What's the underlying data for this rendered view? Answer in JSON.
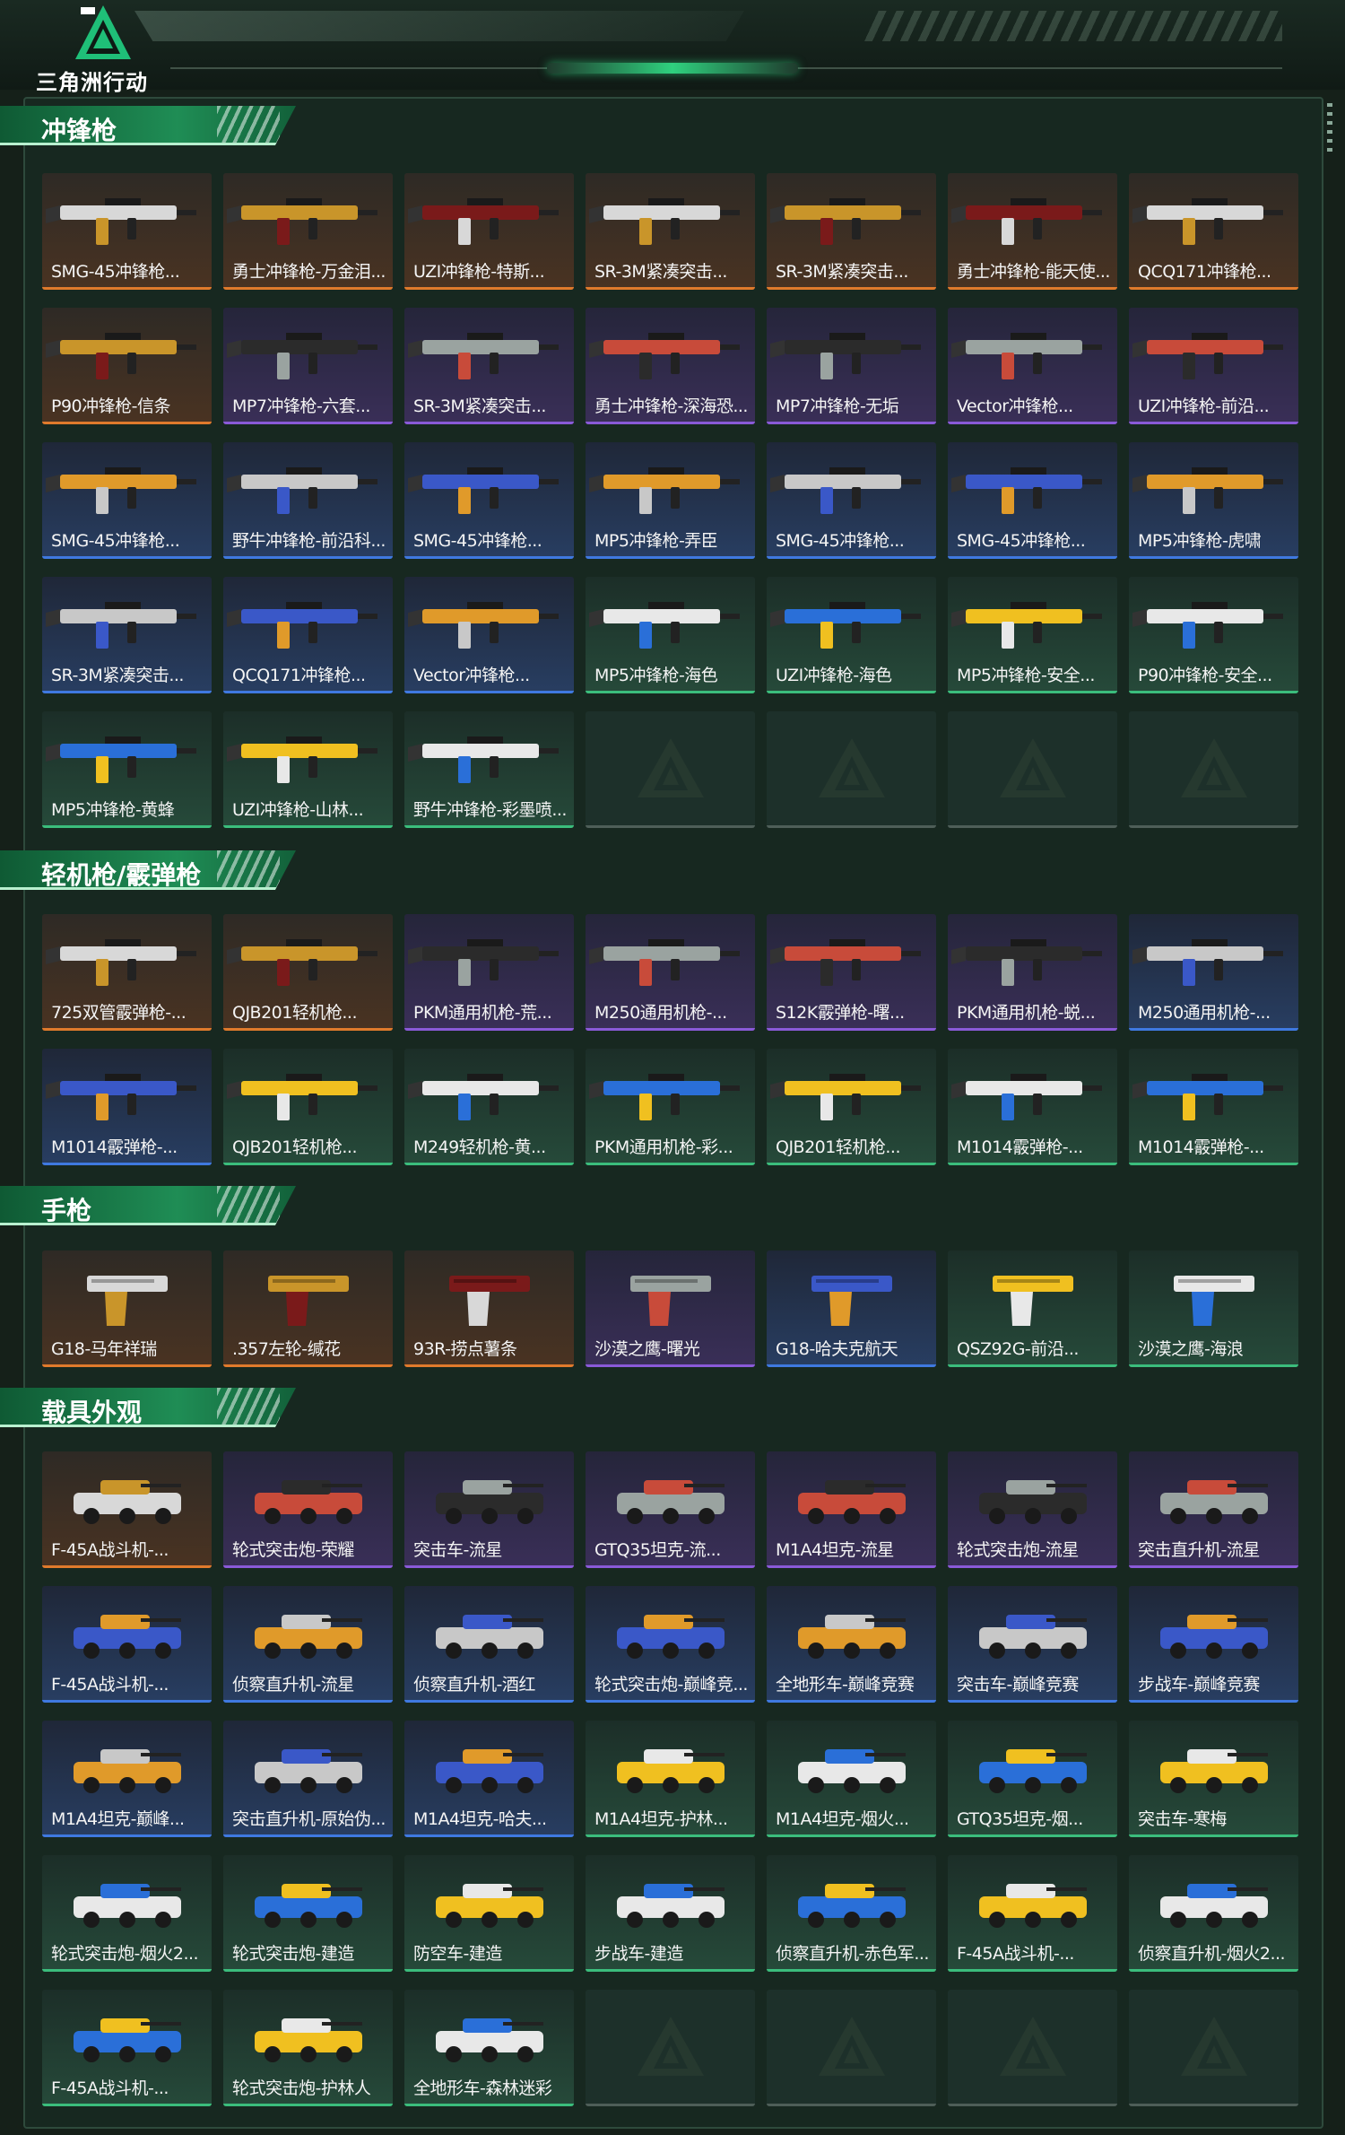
{
  "app": {
    "logo_text": "三角洲行动"
  },
  "colors": {
    "orange": "#e07a2c",
    "purple": "#8a5ad8",
    "blue": "#3f79e0",
    "green": "#3bbd7c",
    "accent": "#1f8d55"
  },
  "sections": [
    {
      "title": "冲锋枪",
      "kind": "gun",
      "items": [
        {
          "name": "SMG-45冲锋枪...",
          "rarity": "orange"
        },
        {
          "name": "勇士冲锋枪-万金泪...",
          "rarity": "orange"
        },
        {
          "name": "UZI冲锋枪-特斯...",
          "rarity": "orange"
        },
        {
          "name": "SR-3M紧凑突击...",
          "rarity": "orange"
        },
        {
          "name": "SR-3M紧凑突击...",
          "rarity": "orange"
        },
        {
          "name": "勇士冲锋枪-能天使...",
          "rarity": "orange"
        },
        {
          "name": "QCQ171冲锋枪...",
          "rarity": "orange"
        },
        {
          "name": "P90冲锋枪-信条",
          "rarity": "orange"
        },
        {
          "name": "MP7冲锋枪-六套...",
          "rarity": "purple"
        },
        {
          "name": "SR-3M紧凑突击...",
          "rarity": "purple"
        },
        {
          "name": "勇士冲锋枪-深海恐...",
          "rarity": "purple"
        },
        {
          "name": "MP7冲锋枪-无垢",
          "rarity": "purple"
        },
        {
          "name": "Vector冲锋枪...",
          "rarity": "purple"
        },
        {
          "name": "UZI冲锋枪-前沿...",
          "rarity": "purple"
        },
        {
          "name": "SMG-45冲锋枪...",
          "rarity": "blue"
        },
        {
          "name": "野牛冲锋枪-前沿科...",
          "rarity": "blue"
        },
        {
          "name": "SMG-45冲锋枪...",
          "rarity": "blue"
        },
        {
          "name": "MP5冲锋枪-弄臣",
          "rarity": "blue"
        },
        {
          "name": "SMG-45冲锋枪...",
          "rarity": "blue"
        },
        {
          "name": "SMG-45冲锋枪...",
          "rarity": "blue"
        },
        {
          "name": "MP5冲锋枪-虎啸",
          "rarity": "blue"
        },
        {
          "name": "SR-3M紧凑突击...",
          "rarity": "blue"
        },
        {
          "name": "QCQ171冲锋枪...",
          "rarity": "blue"
        },
        {
          "name": "Vector冲锋枪...",
          "rarity": "blue"
        },
        {
          "name": "MP5冲锋枪-海色",
          "rarity": "green"
        },
        {
          "name": "UZI冲锋枪-海色",
          "rarity": "green"
        },
        {
          "name": "MP5冲锋枪-安全...",
          "rarity": "green"
        },
        {
          "name": "P90冲锋枪-安全...",
          "rarity": "green"
        },
        {
          "name": "MP5冲锋枪-黄蜂",
          "rarity": "green"
        },
        {
          "name": "UZI冲锋枪-山林...",
          "rarity": "green"
        },
        {
          "name": "野牛冲锋枪-彩墨喷...",
          "rarity": "green"
        },
        {
          "name": "",
          "rarity": "empty"
        },
        {
          "name": "",
          "rarity": "empty"
        },
        {
          "name": "",
          "rarity": "empty"
        },
        {
          "name": "",
          "rarity": "empty"
        }
      ]
    },
    {
      "title": "轻机枪/霰弹枪",
      "kind": "gun",
      "items": [
        {
          "name": "725双管霰弹枪-...",
          "rarity": "orange"
        },
        {
          "name": "QJB201轻机枪...",
          "rarity": "orange"
        },
        {
          "name": "PKM通用机枪-荒...",
          "rarity": "purple"
        },
        {
          "name": "M250通用机枪-...",
          "rarity": "purple"
        },
        {
          "name": "S12K霰弹枪-曙...",
          "rarity": "purple"
        },
        {
          "name": "PKM通用机枪-蜕...",
          "rarity": "purple"
        },
        {
          "name": "M250通用机枪-...",
          "rarity": "blue"
        },
        {
          "name": "M1014霰弹枪-...",
          "rarity": "blue"
        },
        {
          "name": "QJB201轻机枪...",
          "rarity": "green"
        },
        {
          "name": "M249轻机枪-黄...",
          "rarity": "green"
        },
        {
          "name": "PKM通用机枪-彩...",
          "rarity": "green"
        },
        {
          "name": "QJB201轻机枪...",
          "rarity": "green"
        },
        {
          "name": "M1014霰弹枪-...",
          "rarity": "green"
        },
        {
          "name": "M1014霰弹枪-...",
          "rarity": "green"
        }
      ]
    },
    {
      "title": "手枪",
      "kind": "pistol",
      "items": [
        {
          "name": "G18-马年祥瑞",
          "rarity": "orange"
        },
        {
          "name": ".357左轮-缄花",
          "rarity": "orange"
        },
        {
          "name": "93R-捞点薯条",
          "rarity": "orange"
        },
        {
          "name": "沙漠之鹰-曙光",
          "rarity": "purple"
        },
        {
          "name": "G18-哈夫克航天",
          "rarity": "blue"
        },
        {
          "name": "QSZ92G-前沿...",
          "rarity": "green"
        },
        {
          "name": "沙漠之鹰-海浪",
          "rarity": "green"
        }
      ]
    },
    {
      "title": "载具外观",
      "kind": "vehicle",
      "items": [
        {
          "name": "F-45A战斗机-...",
          "rarity": "orange"
        },
        {
          "name": "轮式突击炮-荣耀",
          "rarity": "purple"
        },
        {
          "name": "突击车-流星",
          "rarity": "purple"
        },
        {
          "name": "GTQ35坦克-流...",
          "rarity": "purple"
        },
        {
          "name": "M1A4坦克-流星",
          "rarity": "purple"
        },
        {
          "name": "轮式突击炮-流星",
          "rarity": "purple"
        },
        {
          "name": "突击直升机-流星",
          "rarity": "purple"
        },
        {
          "name": "F-45A战斗机-...",
          "rarity": "blue"
        },
        {
          "name": "侦察直升机-流星",
          "rarity": "blue"
        },
        {
          "name": "侦察直升机-酒红",
          "rarity": "blue"
        },
        {
          "name": "轮式突击炮-巅峰竞...",
          "rarity": "blue"
        },
        {
          "name": "全地形车-巅峰竞赛",
          "rarity": "blue"
        },
        {
          "name": "突击车-巅峰竞赛",
          "rarity": "blue"
        },
        {
          "name": "步战车-巅峰竞赛",
          "rarity": "blue"
        },
        {
          "name": "M1A4坦克-巅峰...",
          "rarity": "blue"
        },
        {
          "name": "突击直升机-原始伪...",
          "rarity": "blue"
        },
        {
          "name": "M1A4坦克-哈夫...",
          "rarity": "blue"
        },
        {
          "name": "M1A4坦克-护林...",
          "rarity": "green"
        },
        {
          "name": "M1A4坦克-烟火...",
          "rarity": "green"
        },
        {
          "name": "GTQ35坦克-烟...",
          "rarity": "green"
        },
        {
          "name": "突击车-寒梅",
          "rarity": "green"
        },
        {
          "name": "轮式突击炮-烟火2...",
          "rarity": "green"
        },
        {
          "name": "轮式突击炮-建造",
          "rarity": "green"
        },
        {
          "name": "防空车-建造",
          "rarity": "green"
        },
        {
          "name": "步战车-建造",
          "rarity": "green"
        },
        {
          "name": "侦察直升机-赤色军...",
          "rarity": "green"
        },
        {
          "name": "F-45A战斗机-...",
          "rarity": "green"
        },
        {
          "name": "侦察直升机-烟火2...",
          "rarity": "green"
        },
        {
          "name": "F-45A战斗机-...",
          "rarity": "green"
        },
        {
          "name": "轮式突击炮-护林人",
          "rarity": "green"
        },
        {
          "name": "全地形车-森林迷彩",
          "rarity": "green"
        },
        {
          "name": "",
          "rarity": "empty"
        },
        {
          "name": "",
          "rarity": "empty"
        },
        {
          "name": "",
          "rarity": "empty"
        },
        {
          "name": "",
          "rarity": "empty"
        }
      ]
    }
  ]
}
